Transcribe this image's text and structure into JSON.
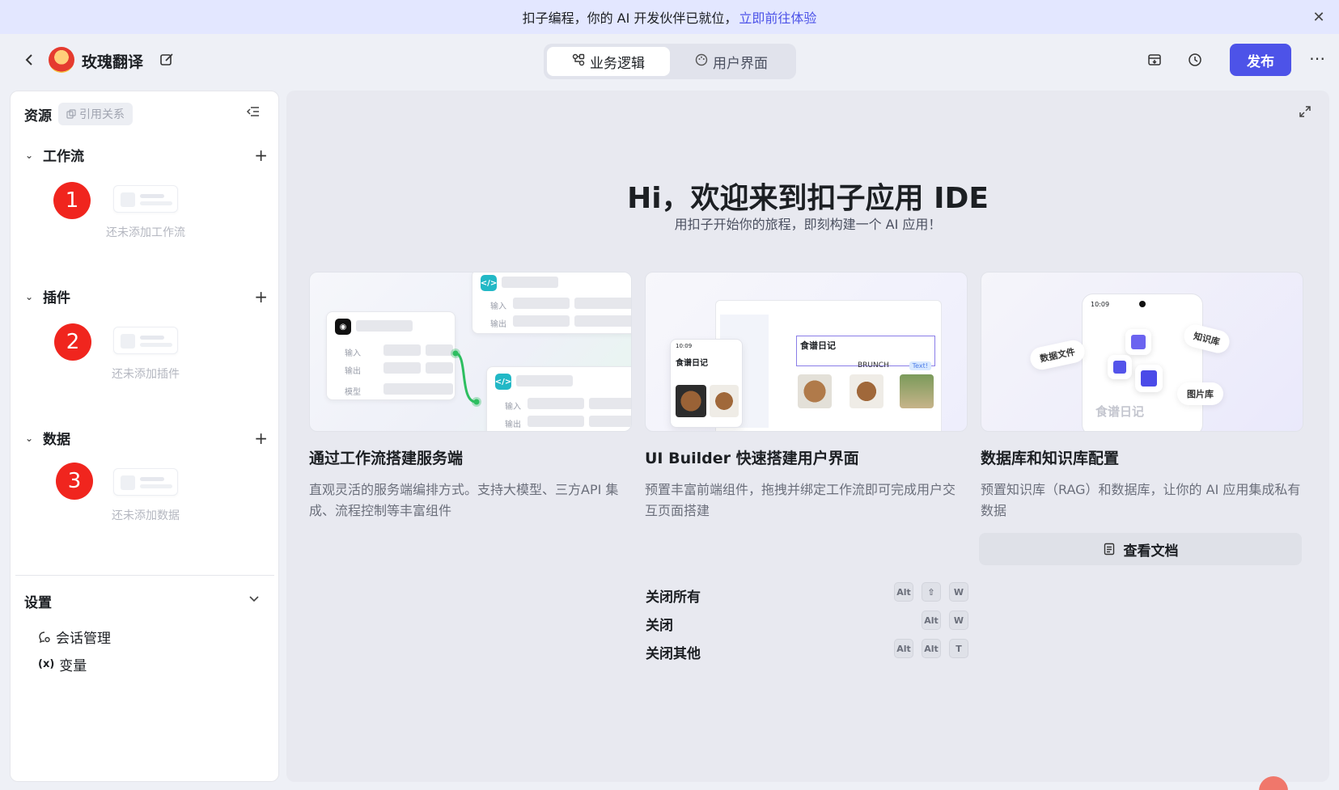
{
  "banner": {
    "text": "扣子编程，你的 AI 开发伙伴已就位，",
    "link": "立即前往体验",
    "close_icon": "close-icon"
  },
  "header": {
    "app_name": "玫瑰翻译",
    "tabs": [
      {
        "label": "业务逻辑",
        "icon": "workflow-icon",
        "active": true
      },
      {
        "label": "用户界面",
        "icon": "palette-icon",
        "active": false
      }
    ],
    "publish_label": "发布"
  },
  "sidebar": {
    "title": "资源",
    "ref_label": "引用关系",
    "sections": [
      {
        "title": "工作流",
        "badge": "1",
        "empty_text": "还未添加工作流"
      },
      {
        "title": "插件",
        "badge": "2",
        "empty_text": "还未添加插件"
      },
      {
        "title": "数据",
        "badge": "3",
        "empty_text": "还未添加数据"
      }
    ],
    "settings": {
      "title": "设置",
      "items": [
        {
          "label": "会话管理",
          "icon": "chat-settings-icon"
        },
        {
          "label": "变量",
          "icon": "variable-icon"
        }
      ]
    }
  },
  "main": {
    "welcome_title": "Hi，欢迎来到扣子应用 IDE",
    "welcome_subtitle": "用扣子开始你的旅程，即刻构建一个 AI 应用！",
    "cards": [
      {
        "title": "通过工作流搭建服务端",
        "desc": "直观灵活的服务端编排方式。支持大模型、三方API 集成、流程控制等丰富组件",
        "thumb_labels": {
          "input": "输入",
          "output": "输出",
          "model": "模型"
        }
      },
      {
        "title": "UI Builder 快速搭建用户界面",
        "desc": "预置丰富前端组件，拖拽并绑定工作流即可完成用户交互页面搭建",
        "thumb_labels": {
          "recipe": "食谱日记",
          "phone_time": "10:09",
          "text_tag": "Text!",
          "brunch": "BRUNCH"
        }
      },
      {
        "title": "数据库和知识库配置",
        "desc": "预置知识库（RAG）和数据库，让你的 AI 应用集成私有数据",
        "thumb_labels": {
          "phone_time": "10:09",
          "data_file": "数据文件",
          "knowledge": "知识库",
          "image_lib": "图片库",
          "recipe": "食谱日记"
        }
      }
    ],
    "docs_label": "查看文档",
    "shortcuts": [
      {
        "label": "关闭所有",
        "keys": [
          "Alt",
          "⇧",
          "W"
        ]
      },
      {
        "label": "关闭",
        "keys": [
          "Alt",
          "W"
        ]
      },
      {
        "label": "关闭其他",
        "keys": [
          "Alt",
          "Alt",
          "T"
        ]
      }
    ]
  },
  "colors": {
    "accent": "#4d53e8",
    "badge_red": "#f0251e",
    "banner_bg": "#e3e7ff"
  }
}
